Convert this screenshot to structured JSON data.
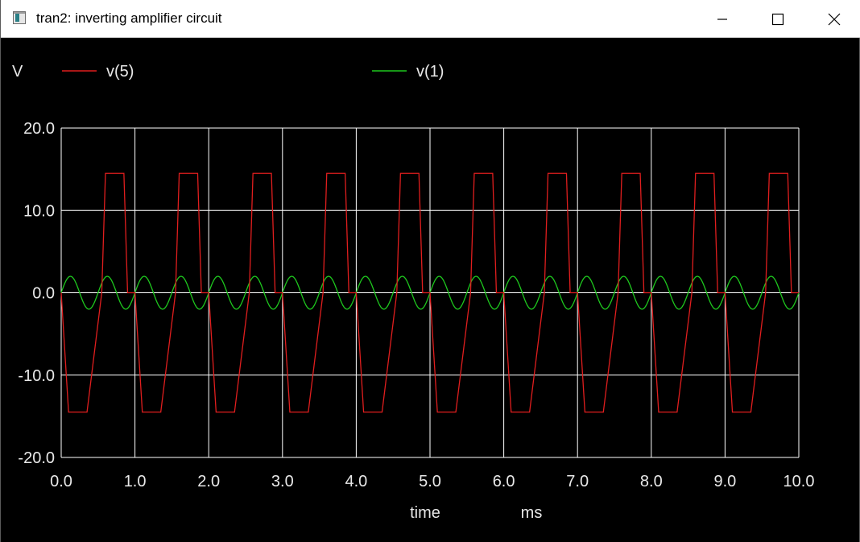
{
  "window": {
    "title": "tran2: inverting amplifier circuit",
    "controls": [
      "minimize-icon",
      "maximize-icon",
      "close-icon"
    ]
  },
  "colors": {
    "background": "#000000",
    "grid": "#ffffff",
    "text": "#e8e8e8",
    "v5": "#e01e1e",
    "v1": "#1ec81e"
  },
  "chart_data": {
    "type": "line",
    "title": "",
    "ylabel": "V",
    "xlabel": "time",
    "xunit": "ms",
    "xlim": [
      0.0,
      10.0
    ],
    "ylim": [
      -20.0,
      20.0
    ],
    "x_ticks": [
      "0.0",
      "1.0",
      "2.0",
      "3.0",
      "4.0",
      "5.0",
      "6.0",
      "7.0",
      "8.0",
      "9.0",
      "10.0"
    ],
    "y_ticks": [
      "20.0",
      "10.0",
      "0.0",
      "-10.0",
      "-20.0"
    ],
    "grid": true,
    "legend_position": "top",
    "series": [
      {
        "name": "v(5)",
        "color": "#e01e1e",
        "description_points": {
          "x": [
            0.0,
            0.1,
            0.35,
            0.55,
            0.6,
            0.85,
            0.9,
            1.0
          ],
          "y": [
            0.0,
            -14.5,
            -14.5,
            0.0,
            14.5,
            14.5,
            0.0,
            0.0
          ]
        }
      },
      {
        "name": "v(1)",
        "color": "#1ec81e",
        "amplitude": 2.0,
        "frequency_khz": 2.0
      }
    ]
  }
}
